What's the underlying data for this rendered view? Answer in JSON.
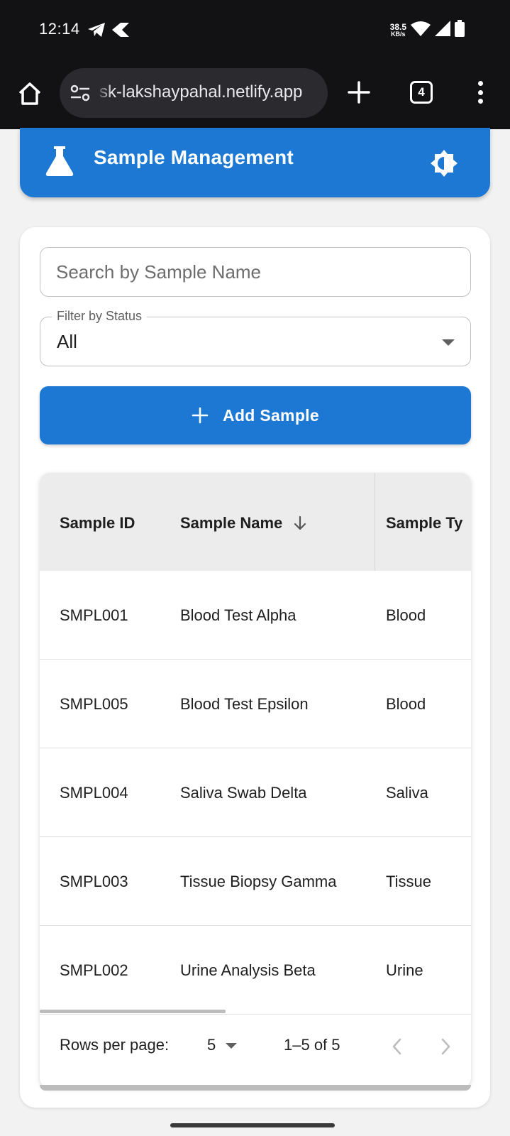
{
  "status_bar": {
    "time": "12:14",
    "net_speed_value": "38.5",
    "net_speed_unit": "KB/s",
    "icons": [
      "telegram-icon",
      "app-notification-icon",
      "wifi-icon",
      "signal-icon",
      "battery-icon"
    ]
  },
  "browser": {
    "url": "sk-lakshaypahal.netlify.app",
    "tab_count": "4",
    "icons": [
      "home-icon",
      "site-settings-icon",
      "new-tab-icon",
      "tab-switcher-icon",
      "more-menu-icon"
    ]
  },
  "app": {
    "title": "Sample Management",
    "brand_color": "#1d78d4",
    "icons": [
      "flask-icon",
      "theme-toggle-icon"
    ]
  },
  "search": {
    "placeholder": "Search by Sample Name",
    "value": ""
  },
  "filter": {
    "label": "Filter by Status",
    "selected": "All"
  },
  "add_button": {
    "label": "Add Sample",
    "icon": "plus-icon"
  },
  "table": {
    "columns": [
      "Sample ID",
      "Sample Name",
      "Sample Type"
    ],
    "visible_third_header": "Sample Ty",
    "sort_column": "Sample Name",
    "sort_direction": "descending",
    "rows": [
      {
        "id": "SMPL001",
        "name": "Blood Test Alpha",
        "type": "Blood"
      },
      {
        "id": "SMPL005",
        "name": "Blood Test Epsilon",
        "type": "Blood"
      },
      {
        "id": "SMPL004",
        "name": "Saliva Swab Delta",
        "type": "Saliva"
      },
      {
        "id": "SMPL003",
        "name": "Tissue Biopsy Gamma",
        "type": "Tissue"
      },
      {
        "id": "SMPL002",
        "name": "Urine Analysis Beta",
        "type": "Urine"
      }
    ]
  },
  "pagination": {
    "rows_per_page_label": "Rows per page:",
    "rows_per_page": "5",
    "range": "1–5 of 5"
  }
}
